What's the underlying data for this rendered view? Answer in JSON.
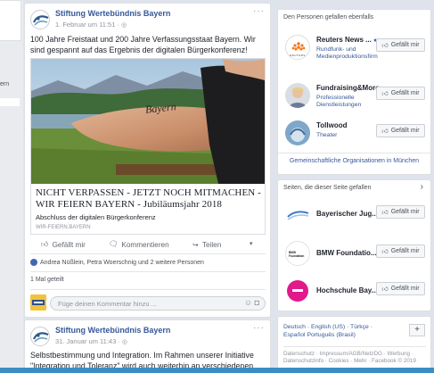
{
  "left_sidebar": {
    "partial_text": "ern"
  },
  "posts": [
    {
      "page_name": "Stiftung Wertebündnis Bayern",
      "date": "1. Februar um 11:51 · ",
      "more": "···",
      "text": "100 Jahre Freistaat und 200 Jahre Verfassungsstaat Bayern. Wir sind gespannt auf das Ergebnis der digitalen Bürgerkonferenz!",
      "link": {
        "title": "NICHT VERPASSEN - JETZT NOCH MITMACHEN - WIR FEIERN BAYERN - Jubiläumsjahr 2018",
        "description": "Abschluss der digitalen Bürgerkonferenz",
        "domain": "WIR-FEIERN.BAYERN",
        "image_text": "Bayern"
      },
      "actions": {
        "like": "Gefällt mir",
        "comment": "Kommentieren",
        "share": "Teilen"
      },
      "reactions": "Andrea Nüßlein, Petra Woerschnig und 2 weitere Personen",
      "shares": "1 Mal geteilt",
      "comment_placeholder": "Füge deinen Kommentar hinzu ..."
    },
    {
      "page_name": "Stiftung Wertebündnis Bayern",
      "date": "31. Januar um 11:43 · ",
      "more": "···",
      "text": "Selbstbestimmung und Integration. Im Rahmen unserer Initiative \"Integration und Toleranz\" wird auch weiterhin an verschiedenen"
    }
  ],
  "right": {
    "liked_title": "Den Personen gefallen ebenfalls",
    "liked": [
      {
        "name": "Reuters News ...",
        "category": "Rundfunk- und Medienproduktionsfirm",
        "button": "Gefällt mir",
        "avatar_text": "REUTERS"
      },
      {
        "name": "Fundraising&More",
        "category": "Professionelle Dienstleistungen",
        "button": "Gefällt mir"
      },
      {
        "name": "Tollwood",
        "category": "Theater",
        "button": "Gefällt mir"
      }
    ],
    "orgs_link": "Gemeinschaftliche Organisationen in München",
    "pages_title": "Seiten, die dieser Seite gefallen",
    "pages_chevron": "›",
    "pages": [
      {
        "name": "Bayerischer Jug...",
        "button": "Gefällt mir"
      },
      {
        "name": "BMW Foundatio...",
        "button": "Gefällt mir",
        "avatar_text": "BMW Foundation"
      },
      {
        "name": "Hochschule Bay...",
        "button": "Gefällt mir"
      }
    ],
    "footer": {
      "languages": "Deutsch · English (US) · Türkçe · Español Português (Brasil)",
      "plus": "+",
      "legal": "Datenschutz · Impressum/AGB/NetzDG · Werbung · Datenschutzinfo · Cookies · Mehr · Facebook © 2019"
    }
  },
  "colors": {
    "link_blue": "#365899",
    "accent": "#4267b2",
    "background": "#dfe3ec"
  }
}
